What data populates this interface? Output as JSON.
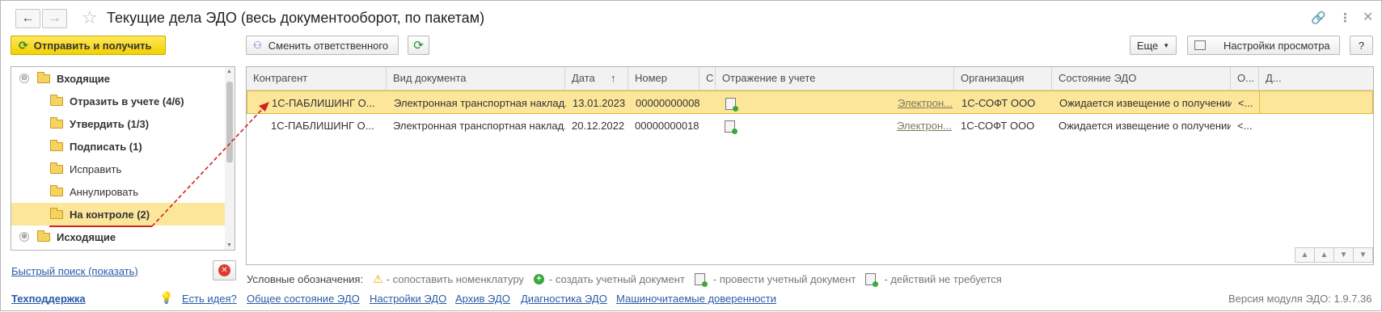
{
  "window": {
    "title": "Текущие дела ЭДО (весь документооборот, по пакетам)"
  },
  "toolbar": {
    "send_receive": "Отправить и получить",
    "change_responsible": "Сменить ответственного",
    "more": "Еще",
    "view_settings": "Настройки просмотра",
    "help": "?"
  },
  "tree": {
    "items": [
      {
        "label": "Входящие",
        "bold": true,
        "expander": "⊖"
      },
      {
        "label": "Отразить в учете (4/6)",
        "bold": true
      },
      {
        "label": "Утвердить (1/3)",
        "bold": true
      },
      {
        "label": "Подписать (1)",
        "bold": true
      },
      {
        "label": "Исправить",
        "bold": false
      },
      {
        "label": "Аннулировать",
        "bold": false
      },
      {
        "label": "На контроле (2)",
        "bold": true,
        "selected": true
      },
      {
        "label": "Исходящие",
        "bold": true,
        "expander": "⊕"
      }
    ]
  },
  "quick_search": "Быстрый поиск (показать)",
  "grid": {
    "columns": [
      "Контрагент",
      "Вид документа",
      "Дата",
      "Номер",
      "С",
      "Отражение в учете",
      "Организация",
      "Состояние ЭДО",
      "О...",
      "Д..."
    ],
    "sort_indicator": "↑",
    "rows": [
      {
        "counterparty": "1С-ПАБЛИШИНГ О...",
        "doc_type": "Электронная транспортная наклад...",
        "date": "13.01.2023",
        "number": "00000000008",
        "reflection_link": "Электрон...",
        "organization": "1С-СОФТ ООО",
        "state": "Ожидается извещение о получении",
        "o": "<...",
        "selected": true
      },
      {
        "counterparty": "1С-ПАБЛИШИНГ О...",
        "doc_type": "Электронная транспортная наклад...",
        "date": "20.12.2022",
        "number": "00000000018",
        "reflection_link": "Электрон...",
        "organization": "1С-СОФТ ООО",
        "state": "Ожидается извещение о получении",
        "o": "<...",
        "selected": false
      }
    ]
  },
  "legend": {
    "title": "Условные обозначения:",
    "items": [
      {
        "icon": "warning-icon",
        "text": "- сопоставить номенклатуру"
      },
      {
        "icon": "plus-circle-icon",
        "text": "- создать учетный документ"
      },
      {
        "icon": "post-document-icon",
        "text": "- провести учетный документ"
      },
      {
        "icon": "no-action-icon",
        "text": "- действий не требуется"
      }
    ]
  },
  "footer": {
    "support": "Техподдержка",
    "links": [
      "Есть идея?",
      "Общее состояние ЭДО",
      "Настройки ЭДО",
      "Архив ЭДО",
      "Диагностика ЭДО",
      "Машиночитаемые доверенности"
    ],
    "version": "Версия модуля ЭДО: 1.9.7.36"
  },
  "colors": {
    "accent_yellow": "#f3d000",
    "selection": "#fbe69a",
    "annotation_red": "#d42020",
    "link_blue": "#2a5aa7"
  }
}
